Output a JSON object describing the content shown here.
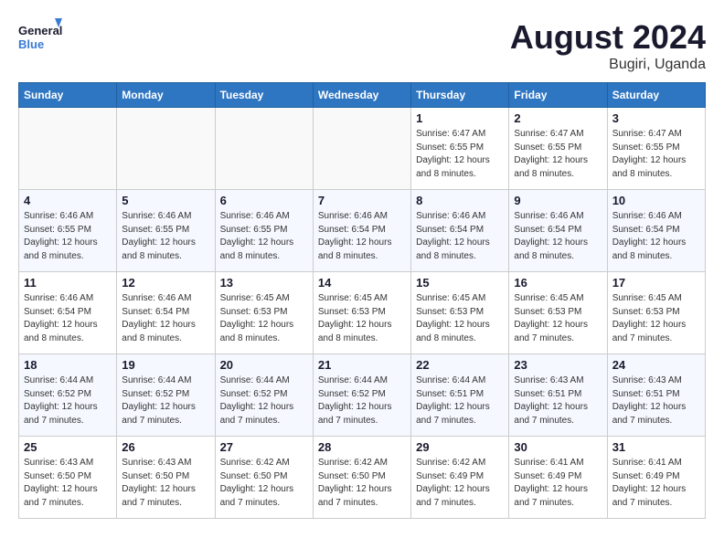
{
  "header": {
    "logo_line1": "General",
    "logo_line2": "Blue",
    "month_year": "August 2024",
    "location": "Bugiri, Uganda"
  },
  "weekdays": [
    "Sunday",
    "Monday",
    "Tuesday",
    "Wednesday",
    "Thursday",
    "Friday",
    "Saturday"
  ],
  "weeks": [
    [
      {
        "day": "",
        "info": ""
      },
      {
        "day": "",
        "info": ""
      },
      {
        "day": "",
        "info": ""
      },
      {
        "day": "",
        "info": ""
      },
      {
        "day": "1",
        "info": "Sunrise: 6:47 AM\nSunset: 6:55 PM\nDaylight: 12 hours\nand 8 minutes."
      },
      {
        "day": "2",
        "info": "Sunrise: 6:47 AM\nSunset: 6:55 PM\nDaylight: 12 hours\nand 8 minutes."
      },
      {
        "day": "3",
        "info": "Sunrise: 6:47 AM\nSunset: 6:55 PM\nDaylight: 12 hours\nand 8 minutes."
      }
    ],
    [
      {
        "day": "4",
        "info": "Sunrise: 6:46 AM\nSunset: 6:55 PM\nDaylight: 12 hours\nand 8 minutes."
      },
      {
        "day": "5",
        "info": "Sunrise: 6:46 AM\nSunset: 6:55 PM\nDaylight: 12 hours\nand 8 minutes."
      },
      {
        "day": "6",
        "info": "Sunrise: 6:46 AM\nSunset: 6:55 PM\nDaylight: 12 hours\nand 8 minutes."
      },
      {
        "day": "7",
        "info": "Sunrise: 6:46 AM\nSunset: 6:54 PM\nDaylight: 12 hours\nand 8 minutes."
      },
      {
        "day": "8",
        "info": "Sunrise: 6:46 AM\nSunset: 6:54 PM\nDaylight: 12 hours\nand 8 minutes."
      },
      {
        "day": "9",
        "info": "Sunrise: 6:46 AM\nSunset: 6:54 PM\nDaylight: 12 hours\nand 8 minutes."
      },
      {
        "day": "10",
        "info": "Sunrise: 6:46 AM\nSunset: 6:54 PM\nDaylight: 12 hours\nand 8 minutes."
      }
    ],
    [
      {
        "day": "11",
        "info": "Sunrise: 6:46 AM\nSunset: 6:54 PM\nDaylight: 12 hours\nand 8 minutes."
      },
      {
        "day": "12",
        "info": "Sunrise: 6:46 AM\nSunset: 6:54 PM\nDaylight: 12 hours\nand 8 minutes."
      },
      {
        "day": "13",
        "info": "Sunrise: 6:45 AM\nSunset: 6:53 PM\nDaylight: 12 hours\nand 8 minutes."
      },
      {
        "day": "14",
        "info": "Sunrise: 6:45 AM\nSunset: 6:53 PM\nDaylight: 12 hours\nand 8 minutes."
      },
      {
        "day": "15",
        "info": "Sunrise: 6:45 AM\nSunset: 6:53 PM\nDaylight: 12 hours\nand 8 minutes."
      },
      {
        "day": "16",
        "info": "Sunrise: 6:45 AM\nSunset: 6:53 PM\nDaylight: 12 hours\nand 7 minutes."
      },
      {
        "day": "17",
        "info": "Sunrise: 6:45 AM\nSunset: 6:53 PM\nDaylight: 12 hours\nand 7 minutes."
      }
    ],
    [
      {
        "day": "18",
        "info": "Sunrise: 6:44 AM\nSunset: 6:52 PM\nDaylight: 12 hours\nand 7 minutes."
      },
      {
        "day": "19",
        "info": "Sunrise: 6:44 AM\nSunset: 6:52 PM\nDaylight: 12 hours\nand 7 minutes."
      },
      {
        "day": "20",
        "info": "Sunrise: 6:44 AM\nSunset: 6:52 PM\nDaylight: 12 hours\nand 7 minutes."
      },
      {
        "day": "21",
        "info": "Sunrise: 6:44 AM\nSunset: 6:52 PM\nDaylight: 12 hours\nand 7 minutes."
      },
      {
        "day": "22",
        "info": "Sunrise: 6:44 AM\nSunset: 6:51 PM\nDaylight: 12 hours\nand 7 minutes."
      },
      {
        "day": "23",
        "info": "Sunrise: 6:43 AM\nSunset: 6:51 PM\nDaylight: 12 hours\nand 7 minutes."
      },
      {
        "day": "24",
        "info": "Sunrise: 6:43 AM\nSunset: 6:51 PM\nDaylight: 12 hours\nand 7 minutes."
      }
    ],
    [
      {
        "day": "25",
        "info": "Sunrise: 6:43 AM\nSunset: 6:50 PM\nDaylight: 12 hours\nand 7 minutes."
      },
      {
        "day": "26",
        "info": "Sunrise: 6:43 AM\nSunset: 6:50 PM\nDaylight: 12 hours\nand 7 minutes."
      },
      {
        "day": "27",
        "info": "Sunrise: 6:42 AM\nSunset: 6:50 PM\nDaylight: 12 hours\nand 7 minutes."
      },
      {
        "day": "28",
        "info": "Sunrise: 6:42 AM\nSunset: 6:50 PM\nDaylight: 12 hours\nand 7 minutes."
      },
      {
        "day": "29",
        "info": "Sunrise: 6:42 AM\nSunset: 6:49 PM\nDaylight: 12 hours\nand 7 minutes."
      },
      {
        "day": "30",
        "info": "Sunrise: 6:41 AM\nSunset: 6:49 PM\nDaylight: 12 hours\nand 7 minutes."
      },
      {
        "day": "31",
        "info": "Sunrise: 6:41 AM\nSunset: 6:49 PM\nDaylight: 12 hours\nand 7 minutes."
      }
    ]
  ]
}
